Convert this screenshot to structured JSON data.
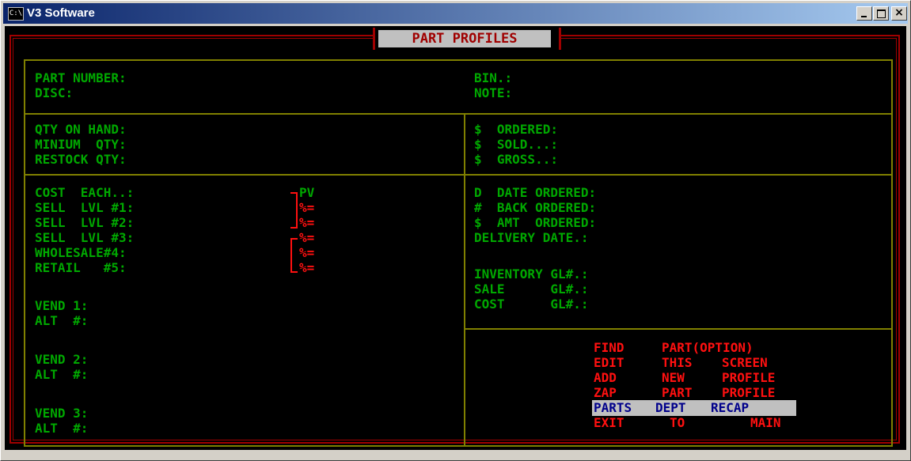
{
  "window": {
    "title": "V3 Software",
    "sys_icon": "C:\\"
  },
  "screen": {
    "header": "PART PROFILES",
    "part_labels": [
      "PART NUMBER:",
      "DISC:"
    ],
    "bin_labels": [
      "BIN.:",
      "NOTE:"
    ],
    "qty_labels": [
      "QTY ON HAND:",
      "MINIUM  QTY:",
      "RESTOCK QTY:"
    ],
    "dollar_labels": [
      "$  ORDERED:",
      "$  SOLD...:",
      "$  GROSS..:"
    ],
    "pricing_labels": [
      "COST  EACH..:",
      "SELL  LVL #1:",
      "SELL  LVL #2:",
      "SELL  LVL #3:",
      "WHOLESALE#4:",
      "RETAIL   #5:"
    ],
    "pv_label": "PV",
    "pct_labels": [
      "%=",
      "%=",
      "%=",
      "%=",
      "%="
    ],
    "order_labels": [
      "D  DATE ORDERED:",
      "#  BACK ORDERED:",
      "$  AMT  ORDERED:",
      "DELIVERY DATE.:"
    ],
    "gl_labels": [
      "INVENTORY GL#.:",
      "SALE      GL#.:",
      "COST      GL#.:"
    ],
    "vendor_labels": [
      "VEND 1:",
      "ALT  #:",
      "VEND 2:",
      "ALT  #:",
      "VEND 3:",
      "ALT  #:"
    ],
    "menu": [
      [
        "FIND",
        "PART(OPTION)"
      ],
      [
        "EDIT",
        "THIS",
        "SCREEN"
      ],
      [
        "ADD",
        "NEW",
        "PROFILE"
      ],
      [
        "ZAP",
        "PART",
        "PROFILE"
      ],
      [
        "PARTS",
        "DEPT",
        "RECAP"
      ],
      [
        "EXIT",
        "TO",
        "MAIN"
      ]
    ],
    "selected_menu_index": 4
  }
}
